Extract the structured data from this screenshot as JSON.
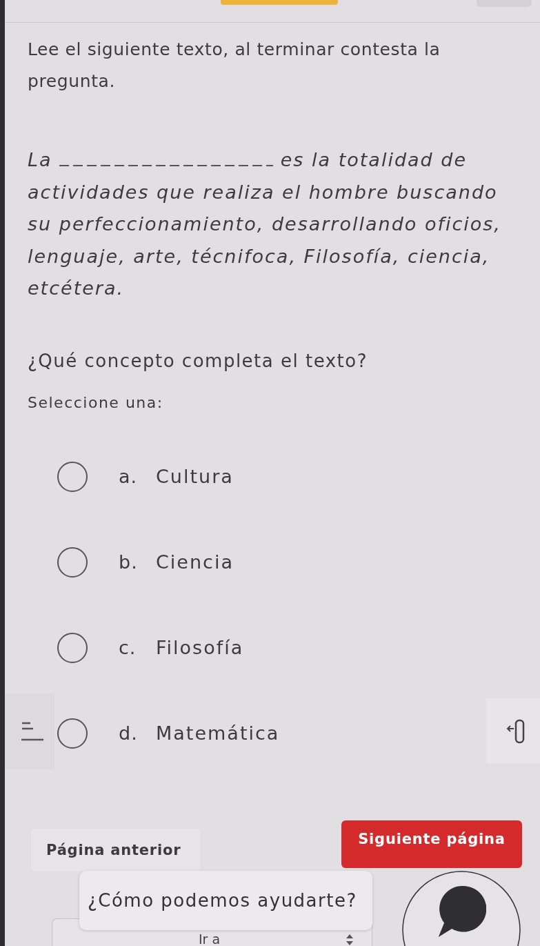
{
  "instruction": "Lee el siguiente texto, al terminar contesta la pregunta.",
  "passage": {
    "before_blank": "La",
    "after_blank": "es la totalidad de actividades que realiza el hombre buscando su perfeccionamiento, desarrollando oficios, lenguaje, arte, técnifoca, Filosofía, ciencia, etcétera."
  },
  "question": "¿Qué concepto completa el texto?",
  "prompt": "Seleccione una:",
  "options": [
    {
      "letter": "a.",
      "text": "Cultura",
      "selected": false
    },
    {
      "letter": "b.",
      "text": "Ciencia",
      "selected": false
    },
    {
      "letter": "c.",
      "text": "Filosofía",
      "selected": false
    },
    {
      "letter": "d.",
      "text": "Matemática",
      "selected": false
    }
  ],
  "navigation": {
    "previous": "Página anterior",
    "next": "Siguiente página"
  },
  "jump_select": {
    "value": "Ir a"
  },
  "chat": {
    "prompt": "¿Cómo podemos ayudarte?"
  }
}
